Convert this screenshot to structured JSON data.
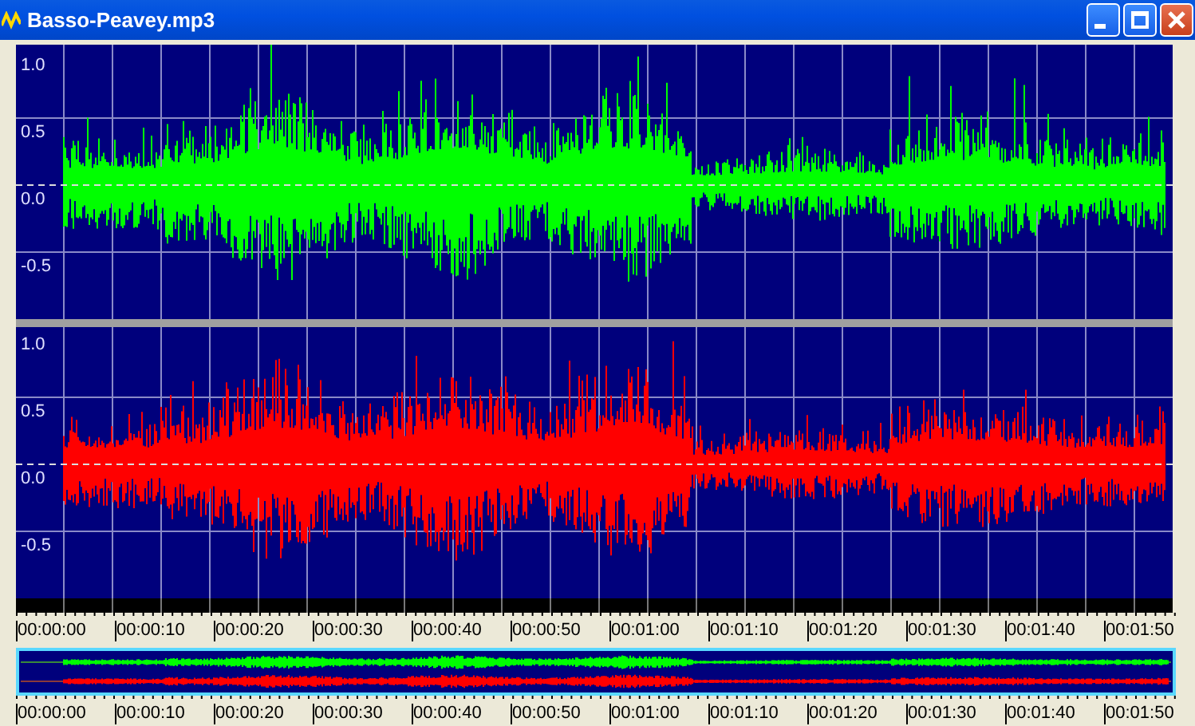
{
  "window": {
    "title": "Basso-Peavey.mp3"
  },
  "channels": [
    {
      "color": "#00ff00",
      "axis_labels": [
        "1.0",
        "0.5",
        "0.0",
        "-0.5"
      ]
    },
    {
      "color": "#ff0000",
      "axis_labels": [
        "1.0",
        "0.5",
        "0.0",
        "-0.5"
      ]
    }
  ],
  "timeline": {
    "labels": [
      "00:00:00",
      "00:00:10",
      "00:00:20",
      "00:00:30",
      "00:00:40",
      "00:00:50",
      "00:01:00",
      "00:01:10",
      "00:01:20",
      "00:01:30",
      "00:01:40",
      "00:01:50"
    ]
  },
  "overview": {
    "timeline_labels": [
      "00:00:00",
      "00:00:10",
      "00:00:20",
      "00:00:30",
      "00:00:40",
      "00:00:50",
      "00:01:00",
      "00:01:10",
      "00:01:20",
      "00:01:30",
      "00:01:40",
      "00:01:50"
    ]
  }
}
